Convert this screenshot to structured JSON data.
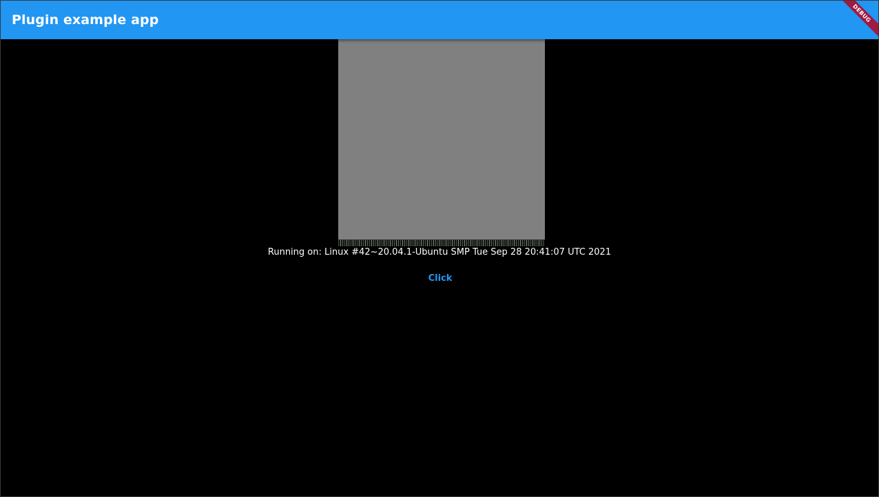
{
  "app_bar": {
    "title": "Plugin example app",
    "color": "#2196f3"
  },
  "debug_banner": {
    "label": "DEBUG",
    "color": "#a01a42"
  },
  "main": {
    "image": {
      "fill_color": "#808080"
    },
    "platform_text": "Running on: Linux #42~20.04.1-Ubuntu SMP Tue Sep 28 20:41:07 UTC 2021",
    "click_button": {
      "label": "Click",
      "color": "#2196f3"
    }
  }
}
